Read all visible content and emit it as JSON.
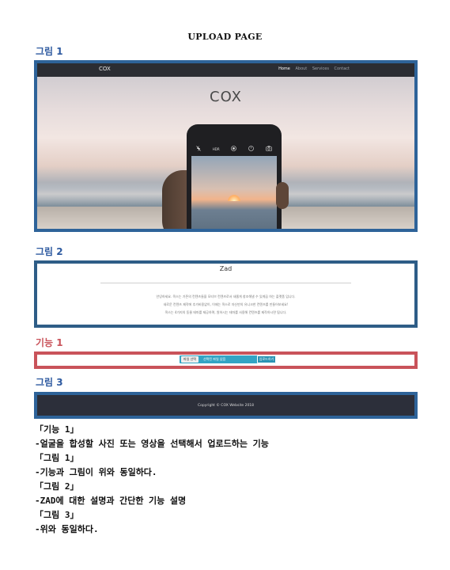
{
  "document": {
    "title": "UPLOAD PAGE"
  },
  "labels": {
    "figure1": "그림 1",
    "figure2": "그림 2",
    "feature1": "기능 1",
    "figure3": "그림 3"
  },
  "colors": {
    "figure_label": "#2e5aa0",
    "feature_label": "#c9535a",
    "figure_border": "#2e6399",
    "feature_border": "#c9535a",
    "upload_bar": "#33a4c4",
    "footer_bg": "#2c2f3a"
  },
  "figure1": {
    "navbar": {
      "brand": "COX",
      "links": [
        "Home",
        "About",
        "Services",
        "Contact"
      ],
      "active_link": "Home"
    },
    "hero_title": "COX",
    "phone_icons": [
      "flash-off-icon",
      "hdr-text",
      "live-photo-icon",
      "timer-icon",
      "camera-switch-icon"
    ],
    "phone_hdr_text": "HDR"
  },
  "figure2": {
    "title": "Zad",
    "lines": [
      "안녕하세요. 콕스는 기존의 컨텐츠들을 모티브 컨텐츠로서 새롭게 창조해낼 수 있게끔 하는 플랫폼 입니다.",
      "새로운 컨텐츠 제작에 추가비용없이, 이제는 콕스로 자신만의 유니크한 컨텐츠를 만들어보세요!",
      "콕스는 4가지의 동물 테마를 제공하며, 원하시는 테마를 사용해 컨텐츠를 제작하시면 됩니다."
    ]
  },
  "feature1": {
    "file_button": "파일 선택",
    "file_status": "선택된 파일 없음",
    "upload_button": "업로드하기"
  },
  "figure3": {
    "footer": "Copyright © COX Website 2018"
  },
  "notes": [
    "「기능 1」",
    "-얼굴을 합성할 사진 또는 영상을 선택해서 업로드하는 기능",
    "「그림 1」",
    "-기능과 그림이 위와 동일하다.",
    "「그림 2」",
    "-ZAD에 대한 설명과 간단한 기능 설명",
    "「그림 3」",
    "-위와 동일하다."
  ]
}
